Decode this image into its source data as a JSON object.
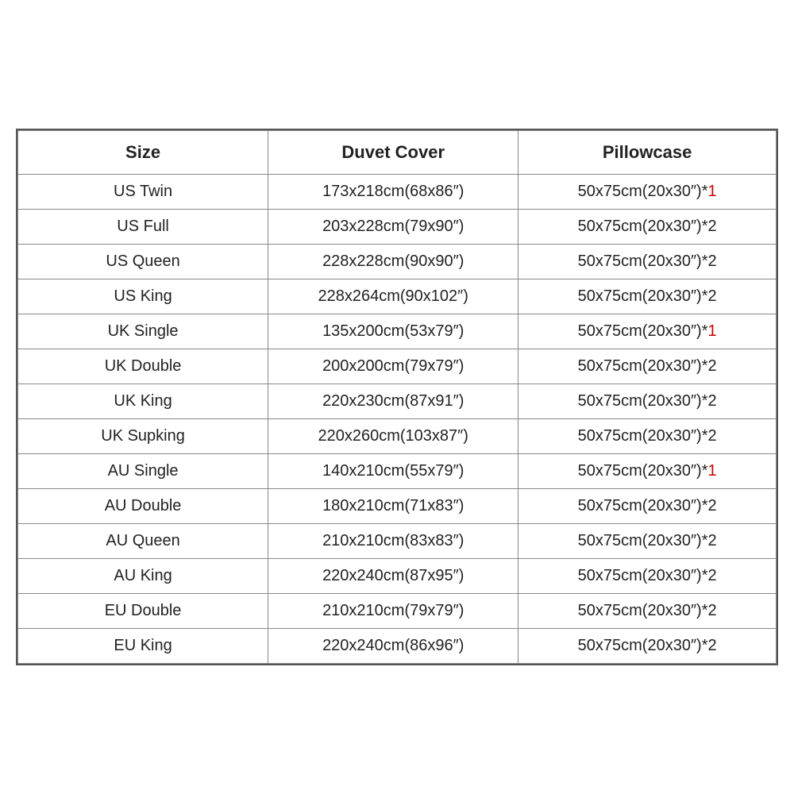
{
  "table": {
    "headers": {
      "size": "Size",
      "duvet": "Duvet Cover",
      "pillow": "Pillowcase"
    },
    "rows": [
      {
        "size": "US Twin",
        "duvet": "173x218cm(68x86″)",
        "pillow_base": "50x75cm(20x30″)*",
        "pillow_count": "1",
        "pillow_red": true
      },
      {
        "size": "US Full",
        "duvet": "203x228cm(79x90″)",
        "pillow_base": "50x75cm(20x30″)*",
        "pillow_count": "2",
        "pillow_red": false
      },
      {
        "size": "US Queen",
        "duvet": "228x228cm(90x90″)",
        "pillow_base": "50x75cm(20x30″)*",
        "pillow_count": "2",
        "pillow_red": false
      },
      {
        "size": "US King",
        "duvet": "228x264cm(90x102″)",
        "pillow_base": "50x75cm(20x30″)*",
        "pillow_count": "2",
        "pillow_red": false
      },
      {
        "size": "UK Single",
        "duvet": "135x200cm(53x79″)",
        "pillow_base": "50x75cm(20x30″)*",
        "pillow_count": "1",
        "pillow_red": true
      },
      {
        "size": "UK Double",
        "duvet": "200x200cm(79x79″)",
        "pillow_base": "50x75cm(20x30″)*",
        "pillow_count": "2",
        "pillow_red": false
      },
      {
        "size": "UK King",
        "duvet": "220x230cm(87x91″)",
        "pillow_base": "50x75cm(20x30″)*",
        "pillow_count": "2",
        "pillow_red": false
      },
      {
        "size": "UK Supking",
        "duvet": "220x260cm(103x87″)",
        "pillow_base": "50x75cm(20x30″)*",
        "pillow_count": "2",
        "pillow_red": false
      },
      {
        "size": "AU Single",
        "duvet": "140x210cm(55x79″)",
        "pillow_base": "50x75cm(20x30″)*",
        "pillow_count": "1",
        "pillow_red": true
      },
      {
        "size": "AU Double",
        "duvet": "180x210cm(71x83″)",
        "pillow_base": "50x75cm(20x30″)*",
        "pillow_count": "2",
        "pillow_red": false
      },
      {
        "size": "AU Queen",
        "duvet": "210x210cm(83x83″)",
        "pillow_base": "50x75cm(20x30″)*",
        "pillow_count": "2",
        "pillow_red": false
      },
      {
        "size": "AU King",
        "duvet": "220x240cm(87x95″)",
        "pillow_base": "50x75cm(20x30″)*",
        "pillow_count": "2",
        "pillow_red": false
      },
      {
        "size": "EU Double",
        "duvet": "210x210cm(79x79″)",
        "pillow_base": "50x75cm(20x30″)*",
        "pillow_count": "2",
        "pillow_red": false
      },
      {
        "size": "EU King",
        "duvet": "220x240cm(86x96″)",
        "pillow_base": "50x75cm(20x30″)*",
        "pillow_count": "2",
        "pillow_red": false
      }
    ]
  }
}
